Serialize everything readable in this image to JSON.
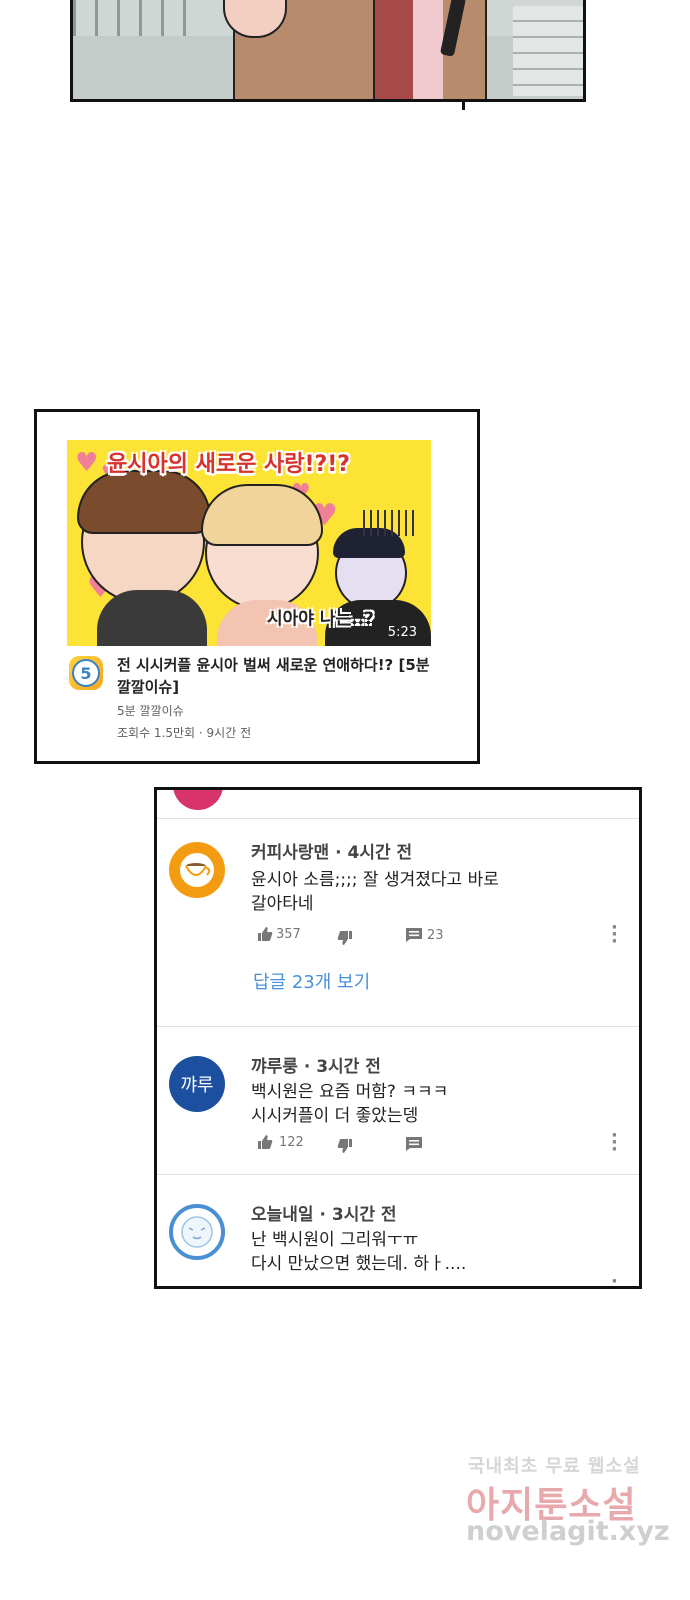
{
  "video": {
    "thumbnail_title": "윤시아의 새로운 사랑!?!?",
    "thumbnail_subtitle": "시아야 나는..?",
    "duration": "5:23",
    "channel_badge": "5",
    "title": "전 시시커플 윤시아 벌써 새로운 연애하다!? [5분 깔깔이슈]",
    "channel_name": "5분 깔깔이슈",
    "meta": "조회수 1.5만회 · 9시간 전"
  },
  "comments": [
    {
      "author": "커피사랑맨",
      "time": "4시간 전",
      "text_line1": "윤시아 소름;;;; 잘 생겨졌다고 바로",
      "text_line2": "갈아타네",
      "likes": "357",
      "replies": "23",
      "view_replies": "답글 23개 보기",
      "avatar_icon": "coffee-cup-icon"
    },
    {
      "author": "꺄루룽",
      "time": "3시간 전",
      "text_line1": "백시원은 요즘 머함? ㅋㅋㅋ",
      "text_line2": "시시커플이 더 좋았는뎅",
      "likes": "122",
      "avatar_text": "꺄루"
    },
    {
      "author": "오늘내일",
      "time": "3시간 전",
      "text_line1": "난 백시원이 그리워ㅜㅠ",
      "text_line2": "다시 만났으면 했는데. 하ㅏ....",
      "avatar_icon": "face-icon"
    }
  ],
  "separator": " · ",
  "watermark": {
    "line1": "국내최초 무료 웹소설",
    "line2": "아지툰소설",
    "line3": "novelagit.xyz"
  },
  "colors": {
    "accent_link": "#4a90d9",
    "thumbnail_bg": "#fde336",
    "thumb_title": "#d8322e",
    "avatar_coffee": "#f39c12",
    "avatar_blue": "#1c4fa0"
  }
}
